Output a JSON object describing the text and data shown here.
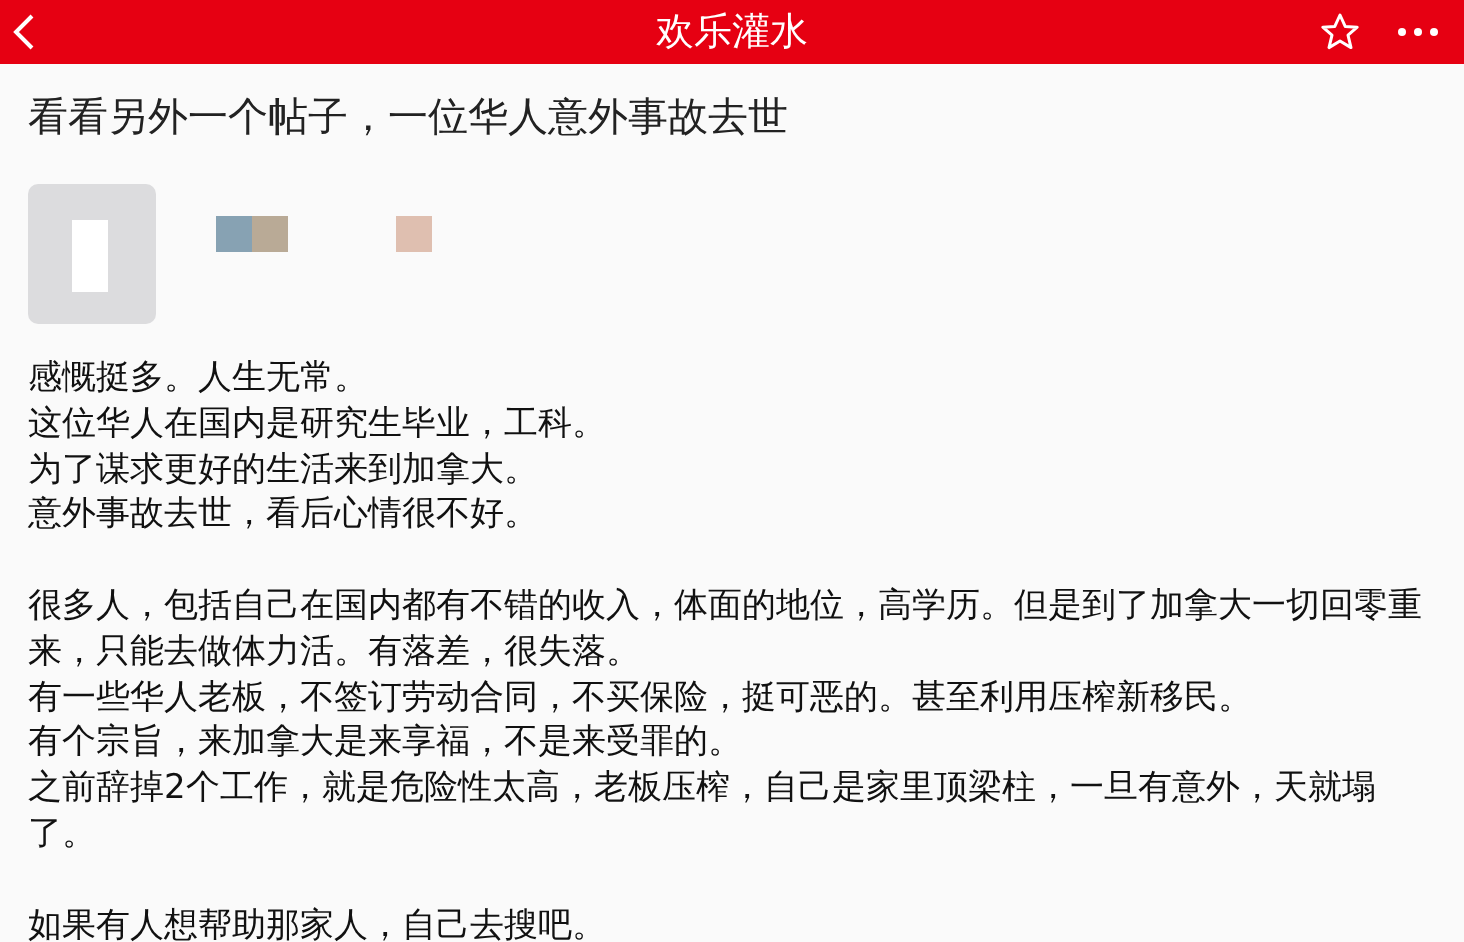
{
  "header": {
    "title": "欢乐灌水"
  },
  "post": {
    "title": "看看另外一个帖子，一位华人意外事故去世",
    "blocks": [
      [
        "感慨挺多。人生无常。",
        "这位华人在国内是研究生毕业，工科。",
        "为了谋求更好的生活来到加拿大。",
        "意外事故去世，看后心情很不好。"
      ],
      [
        "很多人，包括自己在国内都有不错的收入，体面的地位，高学历。但是到了加拿大一切回零重来，只能去做体力活。有落差，很失落。",
        "有一些华人老板，不签订劳动合同，不买保险，挺可恶的。甚至利用压榨新移民。",
        "有个宗旨，来加拿大是来享福，不是来受罪的。",
        "之前辞掉2个工作，就是危险性太高，老板压榨，自己是家里顶梁柱，一旦有意外，天就塌了。"
      ],
      [
        "如果有人想帮助那家人，自己去搜吧。"
      ]
    ]
  }
}
